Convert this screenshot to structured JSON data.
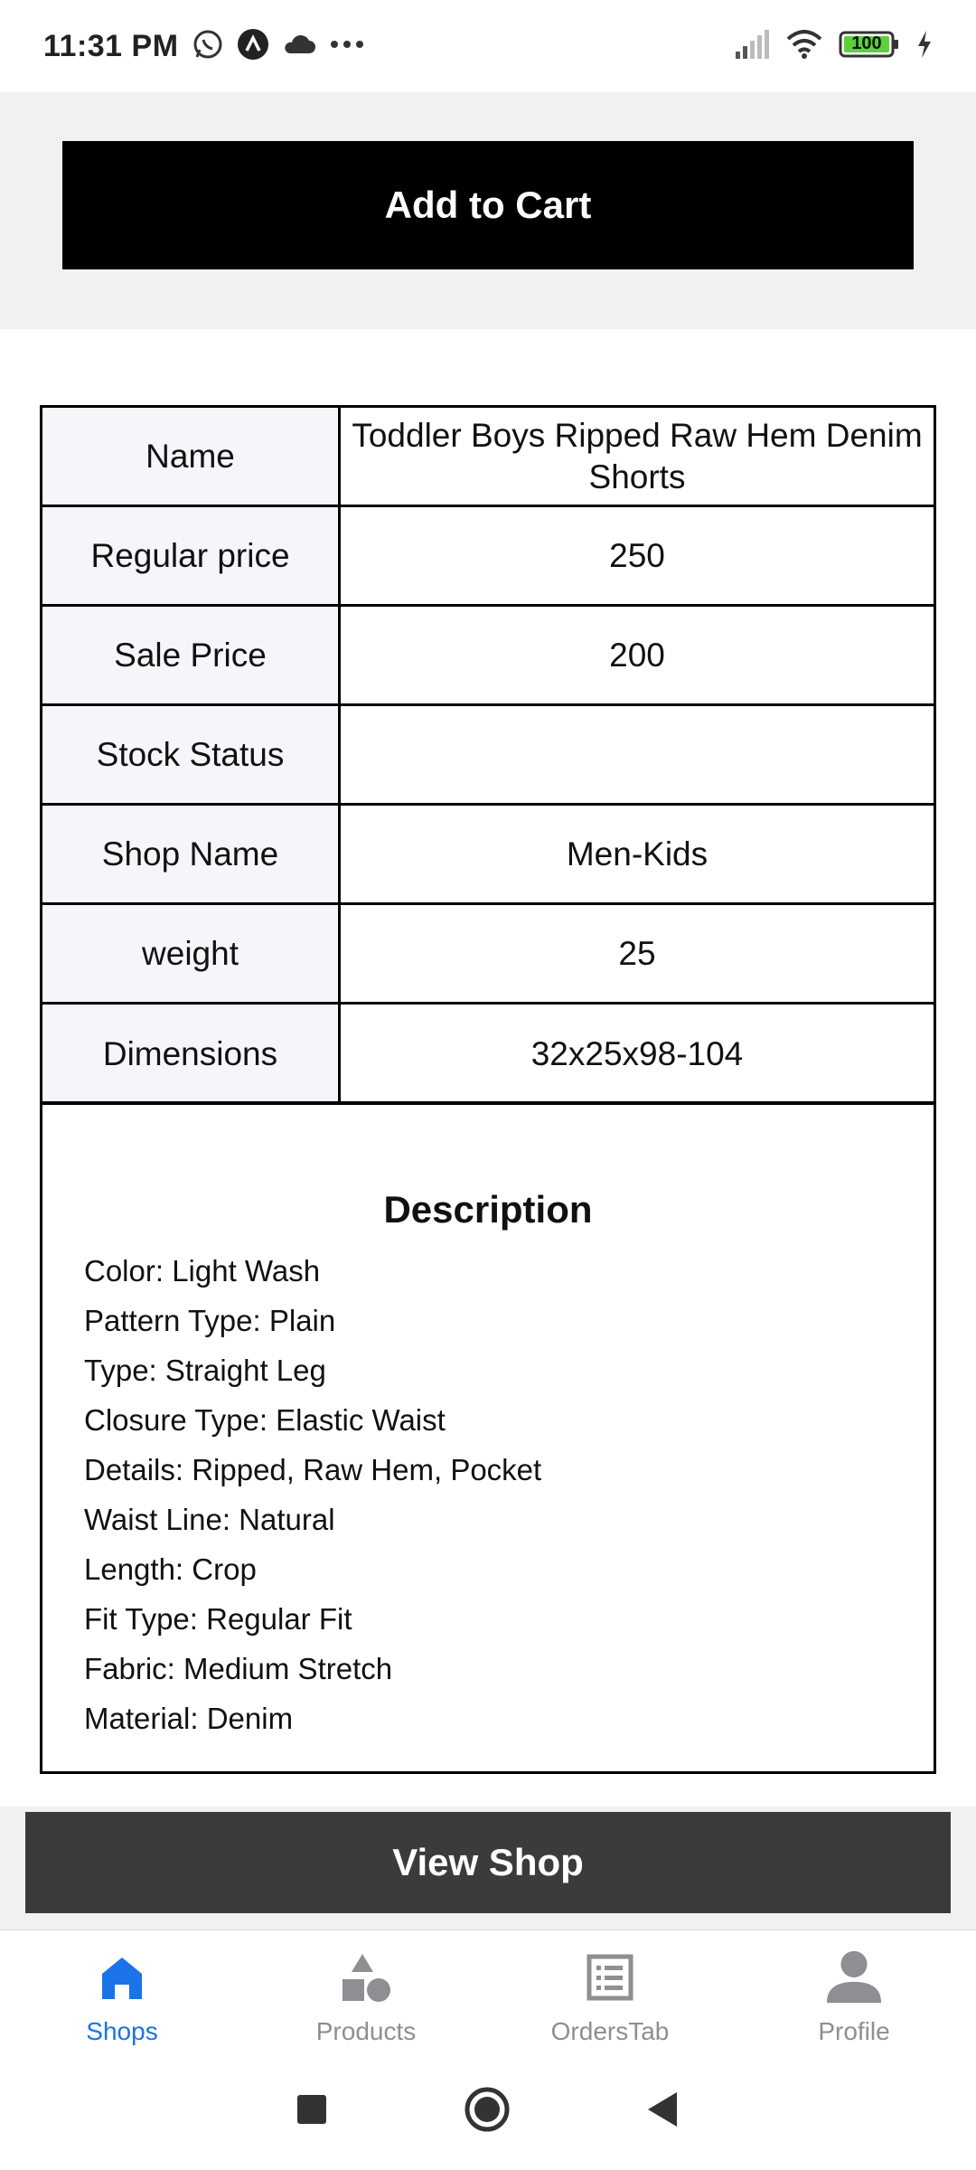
{
  "status_bar": {
    "time": "11:31 PM",
    "battery": "100",
    "icons": [
      "whatsapp-icon",
      "app-a-icon",
      "cloud-icon",
      "more-dots-icon",
      "signal-icon",
      "wifi-icon",
      "battery-icon",
      "charging-icon"
    ]
  },
  "actions": {
    "add_to_cart_label": "Add to Cart",
    "view_shop_label": "View Shop"
  },
  "specs": {
    "rows": [
      {
        "label": "Name",
        "value": "Toddler Boys Ripped Raw Hem Denim Shorts"
      },
      {
        "label": "Regular price",
        "value": "250"
      },
      {
        "label": "Sale Price",
        "value": "200"
      },
      {
        "label": "Stock Status",
        "value": ""
      },
      {
        "label": "Shop Name",
        "value": "Men-Kids"
      },
      {
        "label": "weight",
        "value": "25"
      },
      {
        "label": "Dimensions",
        "value": "32x25x98-104"
      }
    ]
  },
  "description": {
    "title": "Description",
    "lines": [
      "Color: Light Wash",
      "Pattern Type: Plain",
      "Type: Straight Leg",
      "Closure Type: Elastic Waist",
      "Details: Ripped, Raw Hem, Pocket",
      "Waist Line: Natural",
      "Length: Crop",
      "Fit Type: Regular Fit",
      "Fabric: Medium Stretch",
      "Material: Denim"
    ]
  },
  "tabs": [
    {
      "label": "Shops",
      "icon": "shop-icon",
      "active": true
    },
    {
      "label": "Products",
      "icon": "shapes-icon",
      "active": false
    },
    {
      "label": "OrdersTab",
      "icon": "list-icon",
      "active": false
    },
    {
      "label": "Profile",
      "icon": "person-icon",
      "active": false
    }
  ],
  "colors": {
    "active_tab": "#1a73e8",
    "inactive_tab": "#8e8e93",
    "primary_button": "#000000",
    "secondary_button": "#3b3b3b"
  }
}
